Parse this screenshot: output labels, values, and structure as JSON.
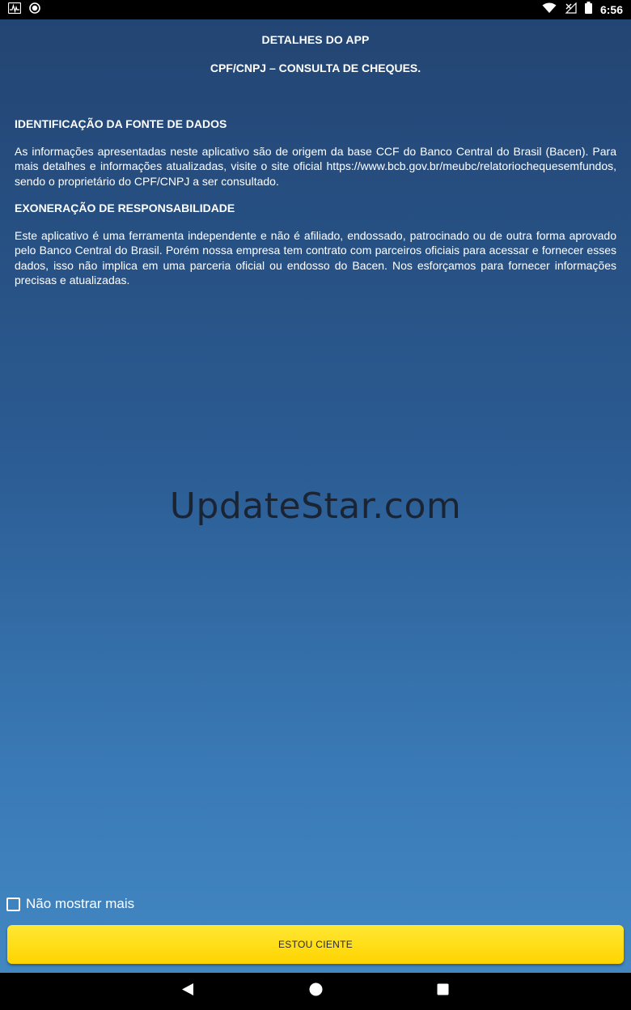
{
  "status_bar": {
    "time": "6:56",
    "icons": [
      "activity-icon",
      "record-icon",
      "wifi-icon",
      "signal-icon",
      "battery-icon"
    ]
  },
  "page": {
    "title": "DETALHES DO APP",
    "app_name": "CPF/CNPJ – CONSULTA DE CHEQUES."
  },
  "sections": [
    {
      "heading": "IDENTIFICAÇÃO DA FONTE DE DADOS",
      "body": "As informações apresentadas neste aplicativo são de origem da base CCF do Banco Central do Brasil (Bacen). Para mais detalhes e informações atualizadas, visite o site oficial https://www.bcb.gov.br/meubc/relatoriochequesemfundos, sendo o proprietário do CPF/CNPJ a ser consultado."
    },
    {
      "heading": "EXONERAÇÃO DE RESPONSABILIDADE",
      "body": "Este aplicativo é uma ferramenta independente e não é afiliado, endossado, patrocinado ou de outra forma aprovado pelo Banco Central do Brasil. Porém nossa empresa tem contrato com parceiros oficiais para acessar e fornecer esses dados, isso não implica em uma parceria oficial ou endosso do Bacen. Nos esforçamos para fornecer informações precisas e atualizadas."
    }
  ],
  "watermark": "UpdateStar.com",
  "checkbox": {
    "label": "Não mostrar mais",
    "checked": false
  },
  "button": {
    "label": "ESTOU CIENTE"
  },
  "colors": {
    "gradient_top": "#234573",
    "gradient_bottom": "#4287c2",
    "button_yellow": "#ffd400"
  }
}
